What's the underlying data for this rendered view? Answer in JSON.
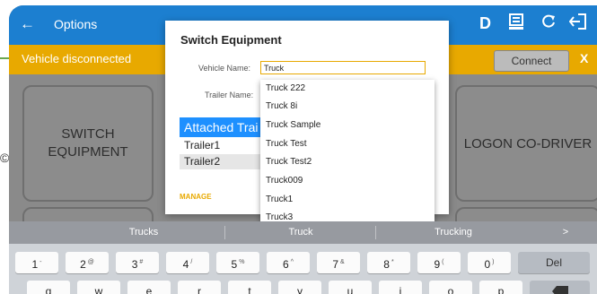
{
  "appbar": {
    "back_icon": "arrow-left-icon",
    "title": "Options",
    "icons": [
      "dashboard-d-icon",
      "document-icon",
      "refresh-icon",
      "logout-icon"
    ],
    "d_label": "D",
    "color": "#1c7fd0"
  },
  "status": {
    "message": "Vehicle disconnected",
    "connect_label": "Connect",
    "close_label": "X",
    "color": "#e8a900"
  },
  "tiles": {
    "switch_equipment": "SWITCH EQUIPMENT",
    "logon_codriver": "LOGON CO-DRIVER"
  },
  "dialog": {
    "title": "Switch Equipment",
    "vehicle_label": "Vehicle Name:",
    "vehicle_value": "Truck",
    "trailer_label": "Trailer Name:",
    "attached_header": "Attached Trai",
    "trailers": [
      "Trailer1",
      "Trailer2"
    ],
    "manage_label": "MANAGE",
    "partial_action": "H"
  },
  "dropdown": {
    "items": [
      "Truck 222",
      "Truck 8i",
      "Truck Sample",
      "Truck Test",
      "Truck Test2",
      "Truck009",
      "Truck1",
      "Truck3"
    ]
  },
  "keyboard": {
    "suggestions": [
      "Trucks",
      "Truck",
      "Trucking"
    ],
    "suggestion_arrow": ">",
    "number_row": [
      {
        "key": "1",
        "alt": "-"
      },
      {
        "key": "2",
        "alt": "@"
      },
      {
        "key": "3",
        "alt": "#"
      },
      {
        "key": "4",
        "alt": "/"
      },
      {
        "key": "5",
        "alt": "%"
      },
      {
        "key": "6",
        "alt": "^"
      },
      {
        "key": "7",
        "alt": "&"
      },
      {
        "key": "8",
        "alt": "*"
      },
      {
        "key": "9",
        "alt": "("
      },
      {
        "key": "0",
        "alt": ")"
      }
    ],
    "delete_label": "Del",
    "letter_row": [
      "q",
      "w",
      "e",
      "r",
      "t",
      "y",
      "u",
      "i",
      "o",
      "p"
    ]
  },
  "edge": {
    "glyph": "©"
  }
}
